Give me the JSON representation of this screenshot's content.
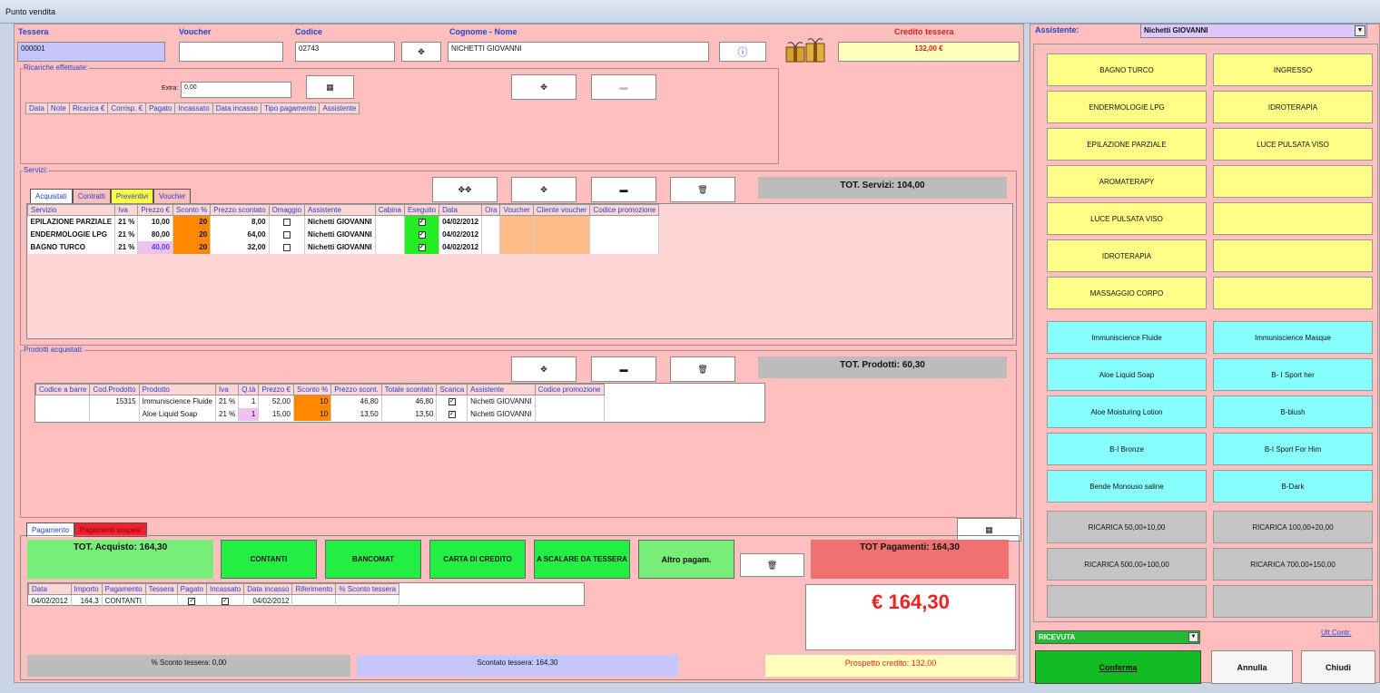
{
  "window_title": "Punto vendita",
  "header": {
    "tessera_label": "Tessera",
    "voucher_label": "Voucher",
    "codice_label": "Codice",
    "nome_label": "Cognome - Nome",
    "credito_label": "Credito tessera",
    "tessera_value": "000001",
    "voucher_value": "",
    "codice_value": "02743",
    "nome_value": "NICHETTI GIOVANNI",
    "credito_value": "132,00 €"
  },
  "ricariche": {
    "label": "Ricariche effettuate:",
    "extra_label": "Extra:",
    "extra_value": "0,00",
    "columns": [
      "Data",
      "Note",
      "Ricarica €",
      "Corrisp. €",
      "Pagato",
      "Incassato",
      "Data incasso",
      "Tipo pagamento",
      "Assistente"
    ]
  },
  "servizi": {
    "label": "Servizi:",
    "total": "TOT. Servizi: 104,00",
    "tabs": [
      "Acquistati",
      "Contratti",
      "Preventivi",
      "Voucher"
    ],
    "columns": [
      "Servizio",
      "Iva",
      "Prezzo €",
      "Sconto %",
      "Prezzo scontato",
      "Omaggio",
      "Assistente",
      "Cabina",
      "Eseguito",
      "Data",
      "Ora",
      "Voucher",
      "Cliente voucher",
      "Codice promozione"
    ],
    "rows": [
      {
        "servizio": "EPILAZIONE PARZIALE",
        "iva": "21 %",
        "prezzo": "10,00",
        "sconto": "20",
        "scontato": "8,00",
        "assistente": "Nichetti GIOVANNI",
        "data": "04/02/2012"
      },
      {
        "servizio": "ENDERMOLOGIE LPG",
        "iva": "21 %",
        "prezzo": "80,00",
        "sconto": "20",
        "scontato": "64,00",
        "assistente": "Nichetti GIOVANNI",
        "data": "04/02/2012"
      },
      {
        "servizio": "BAGNO TURCO",
        "iva": "21 %",
        "prezzo": "40,00",
        "sconto": "20",
        "scontato": "32,00",
        "assistente": "Nichetti GIOVANNI",
        "data": "04/02/2012"
      }
    ]
  },
  "prodotti": {
    "label": "Prodotti acquistati:",
    "total": "TOT. Prodotti: 60,30",
    "columns": [
      "Codice a barre",
      "Cod.Prodotto",
      "Prodotto",
      "Iva",
      "Q.tà",
      "Prezzo €",
      "Sconto %",
      "Prezzo scont.",
      "Totale scontato",
      "Scarica",
      "Assistente",
      "Codice promozione"
    ],
    "rows": [
      {
        "barcode": "",
        "cod": "15315",
        "prodotto": "Immuniscience Fluide",
        "iva": "21 %",
        "qta": "1",
        "prezzo": "52,00",
        "sconto": "10",
        "scont": "46,80",
        "totale": "46,80",
        "assistente": "Nichetti GIOVANNI"
      },
      {
        "barcode": "",
        "cod": "",
        "prodotto": "Aloe Liquid Soap",
        "iva": "21 %",
        "qta": "1",
        "prezzo": "15,00",
        "sconto": "10",
        "scont": "13,50",
        "totale": "13,50",
        "assistente": "Nichetti GIOVANNI"
      }
    ]
  },
  "pagamento": {
    "tabs": [
      "Pagamento",
      "Pagamenti sospesi"
    ],
    "tot_acquisto": "TOT. Acquisto: 164,30",
    "buttons": [
      "CONTANTI",
      "BANCOMAT",
      "CARTA DI CREDITO",
      "A SCALARE DA TESSERA",
      "Altro pagam."
    ],
    "tot_pagamenti": "TOT Pagamenti: 164,30",
    "big_amount": "€ 164,30",
    "columns": [
      "Data",
      "Importo",
      "Pagamento",
      "Tessera",
      "Pagato",
      "Incassato",
      "Data incasso",
      "Riferimento",
      "% Sconto tessera"
    ],
    "rows": [
      {
        "data": "04/02/2012",
        "importo": "164,3",
        "pagamento": "CONTANTI",
        "tessera": "",
        "data_incasso": "04/02/2012"
      }
    ],
    "sconto_tessera": "% Sconto tessera: 0,00",
    "scontato_tessera": "Scontato tessera: 164,30",
    "prospetto": "Prospetto credito: 132,00"
  },
  "right": {
    "assistente_label": "Assistente:",
    "assistente_value": "Nichetti GIOVANNI",
    "yellow": [
      "BAGNO TURCO",
      "INGRESSO",
      "ENDERMOLOGIE LPG",
      "IDROTERAPIA",
      "EPILAZIONE PARZIALE",
      "LUCE PULSATA VISO",
      "AROMATERAPY",
      "",
      "LUCE PULSATA VISO",
      "",
      "IDROTERAPIA",
      "",
      "MASSAGGIO CORPO",
      ""
    ],
    "cyan": [
      "Immuniscience Fluide",
      "Immuniscience Masque",
      "Aloe Liquid Soap",
      "B- I Sport her",
      "Aloe Moisturing Lotion",
      "B-blush",
      "B-I Bronze",
      "B-I Sport For Him",
      "Bende Monouso saline",
      "B-Dark"
    ],
    "gray": [
      "RICARICA 50,00+10,00",
      "RICARICA 100,00+20,00",
      "RICARICA 500,00+100,00",
      "RICARICA 700,00+150,00",
      "",
      ""
    ],
    "doc_type": "RICEVUTA",
    "ult_contr": "Ult.Contr.",
    "conferma": "Conferma",
    "annulla": "Annulla",
    "chiudi": "Chiudi"
  }
}
